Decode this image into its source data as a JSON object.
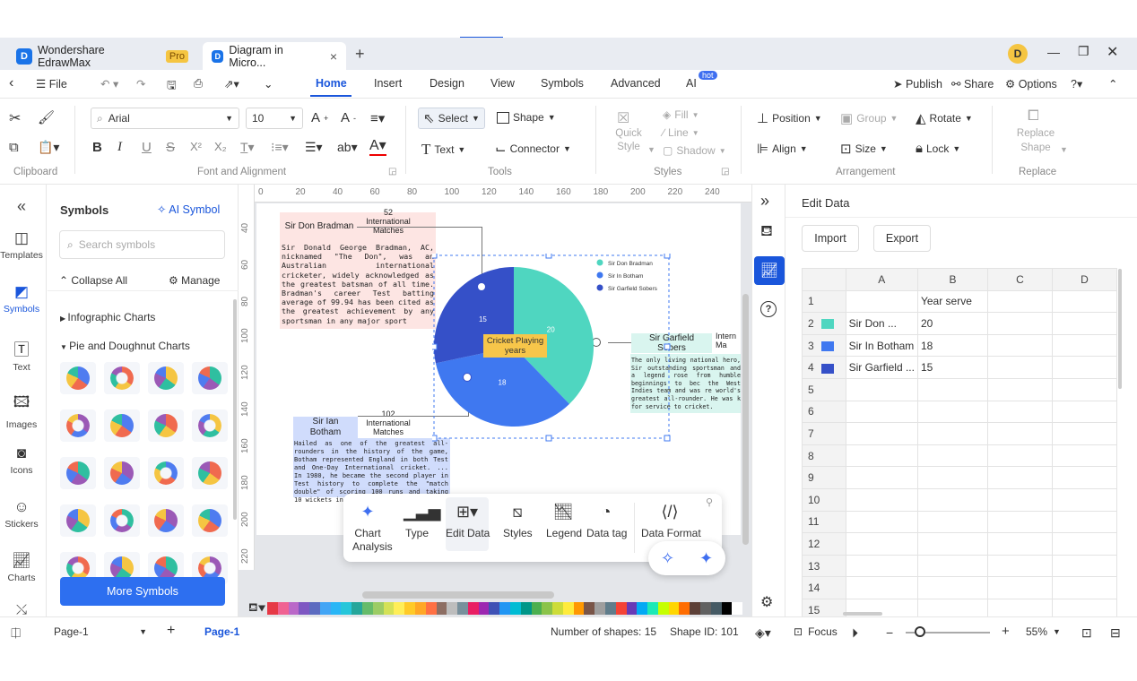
{
  "titlebar": {
    "app_tab": "Wondershare EdrawMax",
    "pro_badge": "Pro",
    "doc_tab": "Diagram in Micro...",
    "close_glyph": "×",
    "new_tab_glyph": "+",
    "avatar_letter": "D"
  },
  "menubar": {
    "file": "File",
    "tabs": [
      "Home",
      "Insert",
      "Design",
      "View",
      "Symbols",
      "Advanced",
      "AI"
    ],
    "ai_badge": "hot",
    "publish": "Publish",
    "share": "Share",
    "options": "Options"
  },
  "ribbon": {
    "clipboard_label": "Clipboard",
    "font_name": "Arial",
    "font_size": "10",
    "font_group_label": "Font and Alignment",
    "select": "Select",
    "shape": "Shape",
    "text": "Text",
    "connector": "Connector",
    "tools_label": "Tools",
    "quick_style": "Quick Style",
    "fill": "Fill",
    "line": "Line",
    "shadow": "Shadow",
    "styles_label": "Styles",
    "position": "Position",
    "group": "Group",
    "rotate": "Rotate",
    "align": "Align",
    "size": "Size",
    "lock": "Lock",
    "arrangement_label": "Arrangement",
    "replace_shape": "Replace Shape",
    "replace_label": "Replace"
  },
  "leftrail": {
    "items": [
      "Templates",
      "Symbols",
      "Text",
      "Images",
      "Icons",
      "Stickers",
      "Charts"
    ]
  },
  "symbols": {
    "title": "Symbols",
    "ai_symbol": "AI Symbol",
    "search_placeholder": "Search symbols",
    "collapse_all": "Collapse All",
    "manage": "Manage",
    "cat_infographic": "Infographic Charts",
    "cat_pie": "Pie and Doughnut Charts",
    "more_symbols": "More Symbols"
  },
  "rulers": {
    "x": [
      "0",
      "20",
      "40",
      "60",
      "80",
      "100",
      "120",
      "140",
      "160",
      "180",
      "200",
      "220",
      "240"
    ],
    "y": [
      "40",
      "60",
      "80",
      "100",
      "120",
      "140",
      "160",
      "180",
      "200",
      "220"
    ]
  },
  "canvas": {
    "bradman_name": "Sir Don Bradman",
    "bradman_stat": "52\nInternational\nMatches",
    "bradman_text": "Sir Donald George Bradman, AC, nicknamed \"The Don\", was an Australian international cricketer, widely acknowledged as the greatest batsman of all time. Bradman's career Test batting average of 99.94 has been cited as the greatest achievement by any sportsman in any major sport",
    "botham_name": "Sir Ian\nBotham",
    "botham_stat": "102\nInternational\nMatches",
    "botham_text": "Hailed as one of the greatest all-rounders in the history of the game, Botham represented England in both Test and One-Day International cricket. ... In 1980, he became the second player in Test history to complete the \"match double\" of scoring 100 runs and taking 10 wickets in the same match.",
    "sobers_name": "Sir Garfield\nSobers",
    "sobers_stat": "Intern\nMa",
    "sobers_text": "The only living national hero, Sir outstanding sportsman and a legend rose from humble beginnings to bec the West Indies team and was re world's greatest all-rounder. He was k for service to cricket.",
    "center_label": "Cricket Playing\nyears"
  },
  "chart_data": {
    "type": "pie",
    "categories": [
      "Sir Don Bradman",
      "Sir In Botham",
      "Sir Garfield Sobers"
    ],
    "values": [
      20,
      18,
      15
    ],
    "colors": [
      "#4fd6c0",
      "#3f78f0",
      "#3550c8"
    ],
    "legend_position": "top-right",
    "center_label": "Cricket Playing\nyears"
  },
  "toolbar": {
    "items": [
      "Chart\nAnalysis",
      "Type",
      "Edit Data",
      "Styles",
      "Legend",
      "Data tag",
      "Data Format"
    ]
  },
  "editdata": {
    "title": "Edit Data",
    "import": "Import",
    "export": "Export",
    "columns": [
      "A",
      "B",
      "C",
      "D"
    ],
    "header_b": "Year serve",
    "rows": [
      {
        "name": "Sir Don ...",
        "value": "20",
        "color": "#4fd6c0"
      },
      {
        "name": "Sir In Botham",
        "value": "18",
        "color": "#3f78f0"
      },
      {
        "name": "Sir Garfield ...",
        "value": "15",
        "color": "#3550c8"
      }
    ],
    "row_numbers": [
      "1",
      "2",
      "3",
      "4",
      "5",
      "6",
      "7",
      "8",
      "9",
      "10",
      "11",
      "12",
      "13",
      "14",
      "15"
    ]
  },
  "statusbar": {
    "page_select": "Page-1",
    "page_tab": "Page-1",
    "shape_count": "Number of shapes: 15",
    "shape_id": "Shape ID: 101",
    "focus": "Focus",
    "zoom": "55%"
  },
  "palette": [
    "#e63946",
    "#f06292",
    "#ba68c8",
    "#7e57c2",
    "#5c6bc0",
    "#42a5f5",
    "#29b6f6",
    "#26c6da",
    "#26a69a",
    "#66bb6a",
    "#9ccc65",
    "#d4e157",
    "#ffee58",
    "#ffca28",
    "#ffa726",
    "#ff7043",
    "#8d6e63",
    "#bdbdbd",
    "#78909c",
    "#e91e63",
    "#9c27b0",
    "#3f51b5",
    "#2196f3",
    "#00bcd4",
    "#009688",
    "#4caf50",
    "#8bc34a",
    "#cddc39",
    "#ffeb3b",
    "#ff9800",
    "#795548",
    "#9e9e9e",
    "#607d8b",
    "#f44336",
    "#673ab7",
    "#03a9f4",
    "#1de9b6",
    "#c6ff00",
    "#ffd600",
    "#ff6d00",
    "#5d4037",
    "#616161",
    "#455a64",
    "#000000",
    "#ffffff"
  ]
}
